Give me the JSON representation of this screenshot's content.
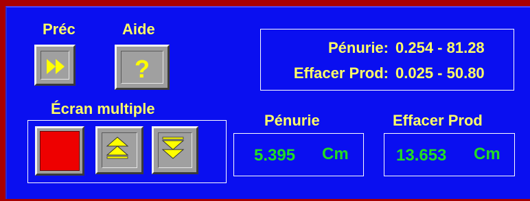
{
  "nav": {
    "prev_label": "Préc",
    "help_label": "Aide",
    "prev_icon": "fast-forward-icon",
    "help_icon": "question-mark-icon",
    "help_glyph": "?"
  },
  "multi": {
    "label": "Écran multiple",
    "stop_icon": "red-square-icon",
    "up_icon": "page-up-icon",
    "down_icon": "page-down-icon"
  },
  "ranges": {
    "shortage_label": "Pénurie:",
    "shortage_range": "0.254 - 81.28",
    "clear_label": "Effacer Prod:",
    "clear_range": "0.025 - 50.80"
  },
  "readouts": {
    "shortage": {
      "label": "Pénurie",
      "value": "5.395",
      "unit": "Cm"
    },
    "clear": {
      "label": "Effacer Prod",
      "value": "13.653",
      "unit": "Cm"
    }
  },
  "colors": {
    "background": "#0a0ff0",
    "frame": "#a80000",
    "label_text": "#ffff66",
    "value_text": "#22dd22",
    "button_face": "#9e9e9e",
    "stop_red": "#ee0000"
  }
}
